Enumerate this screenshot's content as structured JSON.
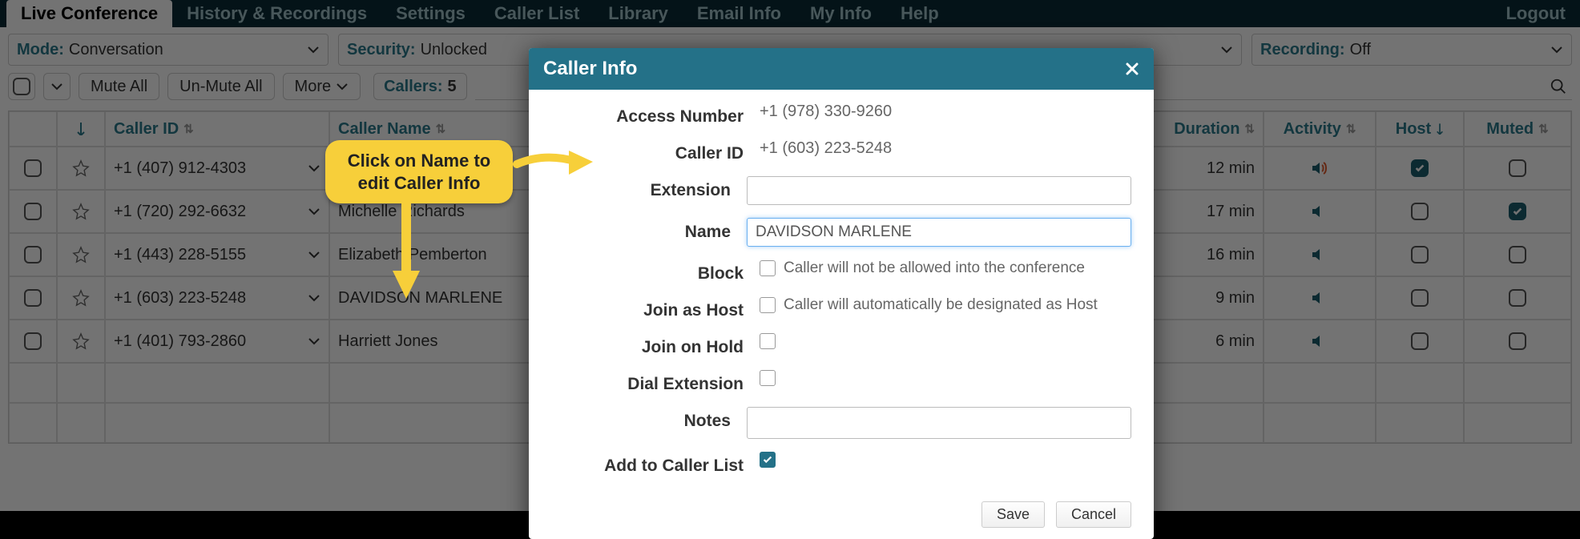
{
  "nav": {
    "tabs": [
      "Live Conference",
      "History & Recordings",
      "Settings",
      "Caller List",
      "Library",
      "Email Info",
      "My Info",
      "Help"
    ],
    "active_index": 0,
    "logout": "Logout"
  },
  "toolbar": {
    "mode": {
      "label": "Mode:",
      "value": "Conversation"
    },
    "security": {
      "label": "Security:",
      "value": "Unlocked"
    },
    "recording": {
      "label": "Recording:",
      "value": "Off"
    },
    "mute_all": "Mute All",
    "unmute_all": "Un-Mute All",
    "more": "More",
    "callers_label": "Callers:",
    "callers_count": "5"
  },
  "columns": {
    "caller_id": "Caller ID",
    "caller_name": "Caller Name",
    "duration": "Duration",
    "activity": "Activity",
    "host": "Host",
    "muted": "Muted"
  },
  "rows": [
    {
      "caller_id": "+1 (407) 912-4303",
      "name": "",
      "duration": "12 min",
      "activity": "active",
      "host": true,
      "muted": false
    },
    {
      "caller_id": "+1 (720) 292-6632",
      "name": "Michelle Richards",
      "duration": "17 min",
      "activity": "idle",
      "host": false,
      "muted": true
    },
    {
      "caller_id": "+1 (443) 228-5155",
      "name": "Elizabeth Pemberton",
      "duration": "16 min",
      "activity": "idle",
      "host": false,
      "muted": false
    },
    {
      "caller_id": "+1 (603) 223-5248",
      "name": "DAVIDSON MARLENE",
      "duration": "9 min",
      "activity": "idle",
      "host": false,
      "muted": false
    },
    {
      "caller_id": "+1 (401) 793-2860",
      "name": "Harriett Jones",
      "duration": "6 min",
      "activity": "idle",
      "host": false,
      "muted": false
    }
  ],
  "modal": {
    "title": "Caller Info",
    "access_number_label": "Access Number",
    "access_number_value": "+1 (978) 330-9260",
    "caller_id_label": "Caller ID",
    "caller_id_value": "+1 (603) 223-5248",
    "extension_label": "Extension",
    "extension_value": "",
    "name_label": "Name",
    "name_value": "DAVIDSON MARLENE",
    "block_label": "Block",
    "block_hint": "Caller will not be allowed into the conference",
    "block_checked": false,
    "join_host_label": "Join as Host",
    "join_host_hint": "Caller will automatically be designated as Host",
    "join_host_checked": false,
    "join_hold_label": "Join on Hold",
    "join_hold_checked": false,
    "dial_ext_label": "Dial Extension",
    "dial_ext_checked": false,
    "notes_label": "Notes",
    "notes_value": "",
    "add_list_label": "Add to Caller List",
    "add_list_checked": true,
    "save": "Save",
    "cancel": "Cancel"
  },
  "callout": {
    "text": "Click on Name to edit Caller Info"
  },
  "colors": {
    "teal": "#247188",
    "accent_yellow": "#f7cf3a"
  }
}
